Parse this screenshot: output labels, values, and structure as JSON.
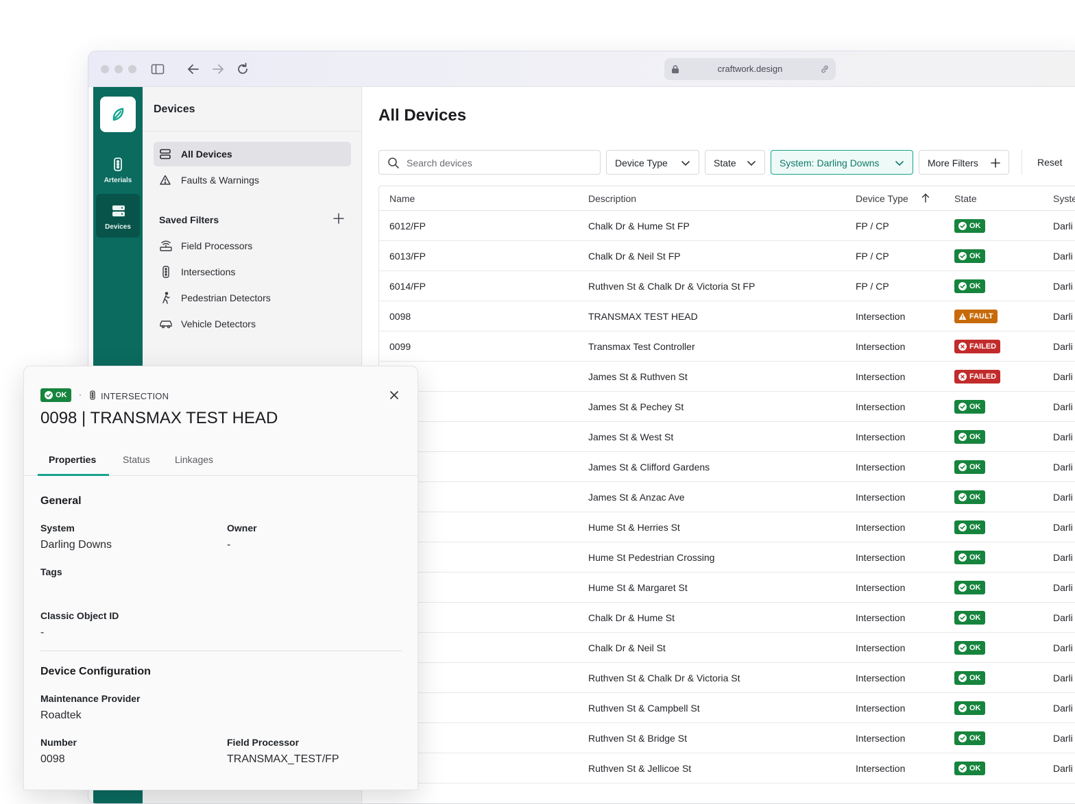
{
  "browser": {
    "url": "craftwork.design"
  },
  "rail": {
    "items": [
      {
        "label": "Arterials"
      },
      {
        "label": "Devices"
      }
    ]
  },
  "sidebar": {
    "title": "Devices",
    "items": [
      {
        "label": "All Devices",
        "active": true
      },
      {
        "label": "Faults & Warnings"
      }
    ],
    "saved_filters_title": "Saved Filters",
    "saved_filters": [
      {
        "label": "Field Processors",
        "icon": "router-icon"
      },
      {
        "label": "Intersections",
        "icon": "traffic-light-icon"
      },
      {
        "label": "Pedestrian Detectors",
        "icon": "pedestrian-icon"
      },
      {
        "label": "Vehicle Detectors",
        "icon": "car-icon"
      }
    ]
  },
  "main": {
    "title": "All Devices",
    "search_placeholder": "Search devices",
    "filters": {
      "device_type": "Device Type",
      "state": "State",
      "system": "System: Darling Downs",
      "more": "More Filters",
      "reset": "Reset"
    },
    "columns": [
      "Name",
      "Description",
      "Device Type",
      "State",
      "Syste"
    ],
    "rows": [
      {
        "name": "6012/FP",
        "desc": "Chalk Dr & Hume St FP",
        "type": "FP / CP",
        "state": "OK",
        "sys": "Darli"
      },
      {
        "name": "6013/FP",
        "desc": "Chalk Dr & Neil St FP",
        "type": "FP / CP",
        "state": "OK",
        "sys": "Darli"
      },
      {
        "name": "6014/FP",
        "desc": "Ruthven St & Chalk Dr & Victoria St FP",
        "type": "FP / CP",
        "state": "OK",
        "sys": "Darli"
      },
      {
        "name": "0098",
        "desc": "TRANSMAX TEST HEAD",
        "type": "Intersection",
        "state": "FAULT",
        "sys": "Darli"
      },
      {
        "name": "0099",
        "desc": "Transmax Test Controller",
        "type": "Intersection",
        "state": "FAILED",
        "sys": "Darli"
      },
      {
        "name": "",
        "desc": "James St & Ruthven St",
        "type": "Intersection",
        "state": "FAILED",
        "sys": "Darli"
      },
      {
        "name": "",
        "desc": "James St & Pechey St",
        "type": "Intersection",
        "state": "OK",
        "sys": "Darli"
      },
      {
        "name": "",
        "desc": "James St & West St",
        "type": "Intersection",
        "state": "OK",
        "sys": "Darli"
      },
      {
        "name": "",
        "desc": "James St & Clifford Gardens",
        "type": "Intersection",
        "state": "OK",
        "sys": "Darli"
      },
      {
        "name": "",
        "desc": "James St & Anzac Ave",
        "type": "Intersection",
        "state": "OK",
        "sys": "Darli"
      },
      {
        "name": "",
        "desc": "Hume St & Herries St",
        "type": "Intersection",
        "state": "OK",
        "sys": "Darli"
      },
      {
        "name": "",
        "desc": "Hume St Pedestrian Crossing",
        "type": "Intersection",
        "state": "OK",
        "sys": "Darli"
      },
      {
        "name": "",
        "desc": "Hume St & Margaret St",
        "type": "Intersection",
        "state": "OK",
        "sys": "Darli"
      },
      {
        "name": "",
        "desc": "Chalk Dr & Hume St",
        "type": "Intersection",
        "state": "OK",
        "sys": "Darli"
      },
      {
        "name": "",
        "desc": "Chalk Dr & Neil St",
        "type": "Intersection",
        "state": "OK",
        "sys": "Darli"
      },
      {
        "name": "",
        "desc": "Ruthven St & Chalk Dr & Victoria St",
        "type": "Intersection",
        "state": "OK",
        "sys": "Darli"
      },
      {
        "name": "",
        "desc": "Ruthven St & Campbell St",
        "type": "Intersection",
        "state": "OK",
        "sys": "Darli"
      },
      {
        "name": "",
        "desc": "Ruthven St & Bridge St",
        "type": "Intersection",
        "state": "OK",
        "sys": "Darli"
      },
      {
        "name": "",
        "desc": "Ruthven St & Jellicoe St",
        "type": "Intersection",
        "state": "OK",
        "sys": "Darli"
      }
    ]
  },
  "panel": {
    "status": "OK",
    "separator": "·",
    "type": "INTERSECTION",
    "title": "0098 | TRANSMAX TEST HEAD",
    "tabs": [
      "Properties",
      "Status",
      "Linkages"
    ],
    "general_title": "General",
    "system_label": "System",
    "system_value": "Darling Downs",
    "owner_label": "Owner",
    "owner_value": "-",
    "tags_label": "Tags",
    "classic_label": "Classic Object ID",
    "classic_value": "-",
    "config_title": "Device Configuration",
    "maint_label": "Maintenance Provider",
    "maint_value": "Roadtek",
    "number_label": "Number",
    "number_value": "0098",
    "fp_label": "Field Processor",
    "fp_value": "TRANSMAX_TEST/FP"
  },
  "colors": {
    "brand": "#0b6b5f",
    "accent": "#17a28d",
    "ok": "#16843d",
    "fault": "#c76a0a",
    "failed": "#c22b2b"
  }
}
